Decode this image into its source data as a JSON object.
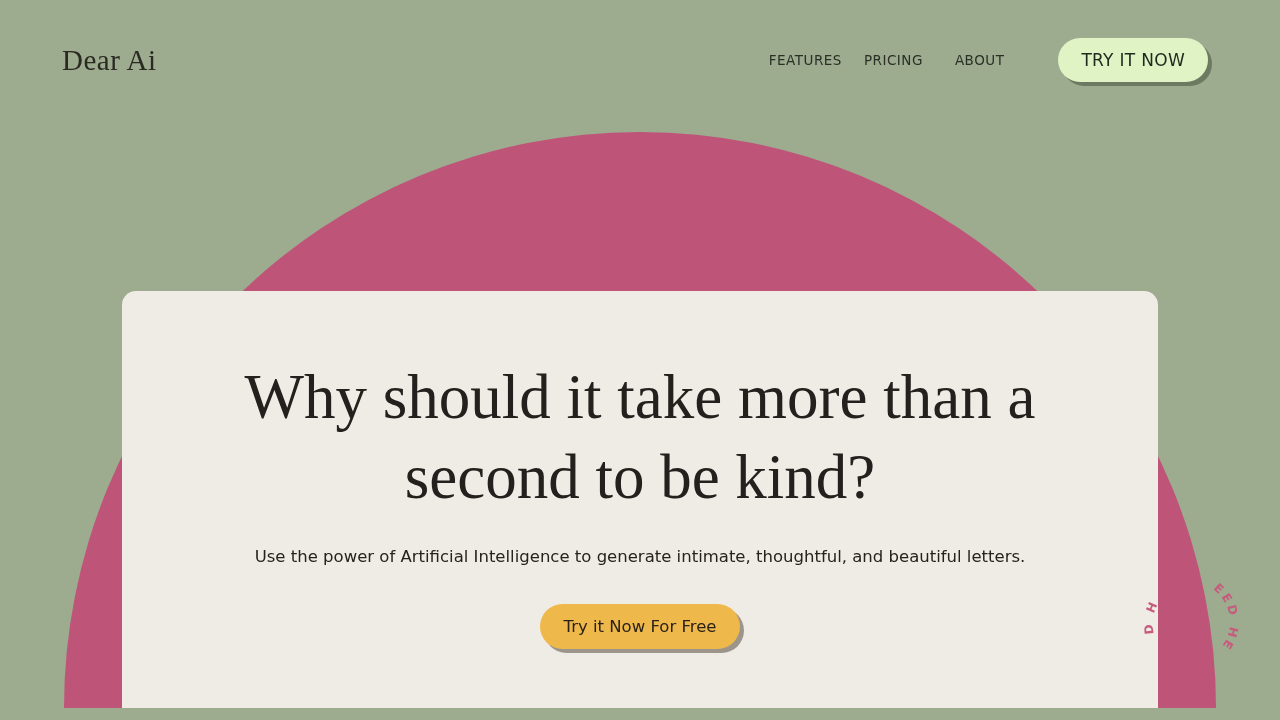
{
  "header": {
    "logo": "Dear Ai",
    "nav": [
      {
        "label": "FEATURES"
      },
      {
        "label": "PRICING"
      },
      {
        "label": "ABOUT"
      }
    ],
    "cta": "TRY IT NOW"
  },
  "hero": {
    "title": "Why should it take more than a second to be kind?",
    "subtitle": "Use the power of Artificial Intelligence to generate intimate, thoughtful, and beautiful letters.",
    "button": "Try it Now For Free"
  },
  "circular_text": [
    "D H",
    "EED HE"
  ]
}
